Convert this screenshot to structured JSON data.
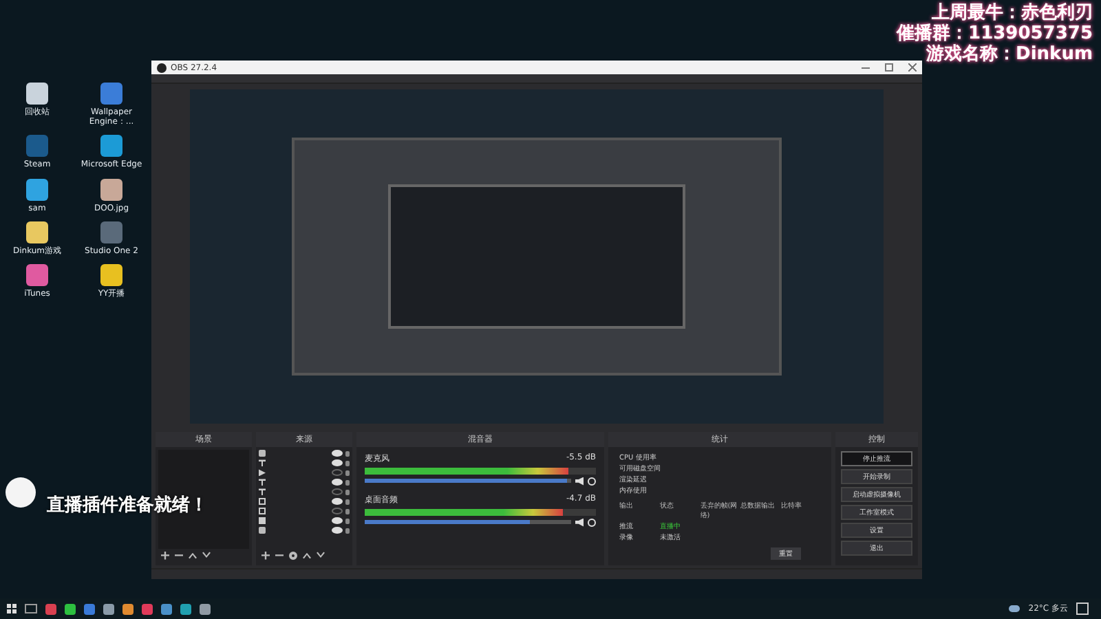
{
  "overlay": {
    "lines": [
      "上周最牛：赤色利刃",
      "催播群：1139057375",
      "游戏名称：Dinkum"
    ]
  },
  "desktop_icons": [
    {
      "label": "回收站",
      "color": "#c9d3dc"
    },
    {
      "label": "Wallpaper Engine：...",
      "color": "#3b7dd8"
    },
    {
      "label": "Steam",
      "color": "#1b5a8c"
    },
    {
      "label": "Microsoft Edge",
      "color": "#1c9bd6"
    },
    {
      "label": "sam",
      "color": "#2fa3e0"
    },
    {
      "label": "DOO.jpg",
      "color": "#c8a898"
    },
    {
      "label": "Dinkum游戏",
      "color": "#e8c860"
    },
    {
      "label": "Studio One 2",
      "color": "#5a6a7a"
    },
    {
      "label": "iTunes",
      "color": "#e05aa0"
    },
    {
      "label": "YY开播",
      "color": "#e8c020"
    }
  ],
  "notification": {
    "text": "直播插件准备就绪！"
  },
  "obs": {
    "title": "OBS 27.2.4",
    "scenes": {
      "title": "场景"
    },
    "sources": {
      "title": "来源",
      "items": [
        {
          "kind": "folder",
          "visible": true
        },
        {
          "kind": "text",
          "visible": true
        },
        {
          "kind": "media",
          "visible": false
        },
        {
          "kind": "text",
          "visible": true
        },
        {
          "kind": "text",
          "visible": false
        },
        {
          "kind": "window",
          "visible": true
        },
        {
          "kind": "window",
          "visible": false
        },
        {
          "kind": "image",
          "visible": true
        },
        {
          "kind": "folder",
          "visible": true
        }
      ]
    },
    "mixer": {
      "title": "混音器",
      "channels": [
        {
          "name": "麦克风",
          "reading": "-5.5 dB",
          "level": 0.88,
          "volume": {
            "level": 0.98
          }
        },
        {
          "name": "桌面音频",
          "reading": "-4.7 dB",
          "level": 0.86,
          "volume": {
            "level": 0.8
          }
        }
      ]
    },
    "stats": {
      "title": "统计",
      "metrics": [
        "CPU 使用率",
        "可用磁盘空间",
        "渲染延迟",
        "内存使用"
      ],
      "columns": [
        "输出",
        "状态",
        "丢弃的帧(网络)",
        "总数据输出",
        "比特率"
      ],
      "rows": [
        {
          "output": "推流",
          "status": "直播中",
          "live": true
        },
        {
          "output": "录像",
          "status": "未激活",
          "live": false
        }
      ],
      "reset": "重置"
    },
    "controls": {
      "title": "控制",
      "buttons": [
        {
          "label": "停止推流",
          "active": true
        },
        {
          "label": "开始录制",
          "active": false
        },
        {
          "label": "启动虚拟摄像机",
          "active": false
        },
        {
          "label": "工作室模式",
          "active": false
        },
        {
          "label": "设置",
          "active": false
        },
        {
          "label": "退出",
          "active": false
        }
      ]
    }
  },
  "taskbar": {
    "apps": [
      {
        "color": "#d94050"
      },
      {
        "color": "#2dc040"
      },
      {
        "color": "#3a7ad8"
      },
      {
        "color": "#8a9aa8"
      },
      {
        "color": "#e08a30"
      },
      {
        "color": "#e03a5a"
      },
      {
        "color": "#4a90c8"
      },
      {
        "color": "#20a0b0"
      },
      {
        "color": "#909aa4"
      }
    ],
    "weather": "22°C 多云"
  }
}
